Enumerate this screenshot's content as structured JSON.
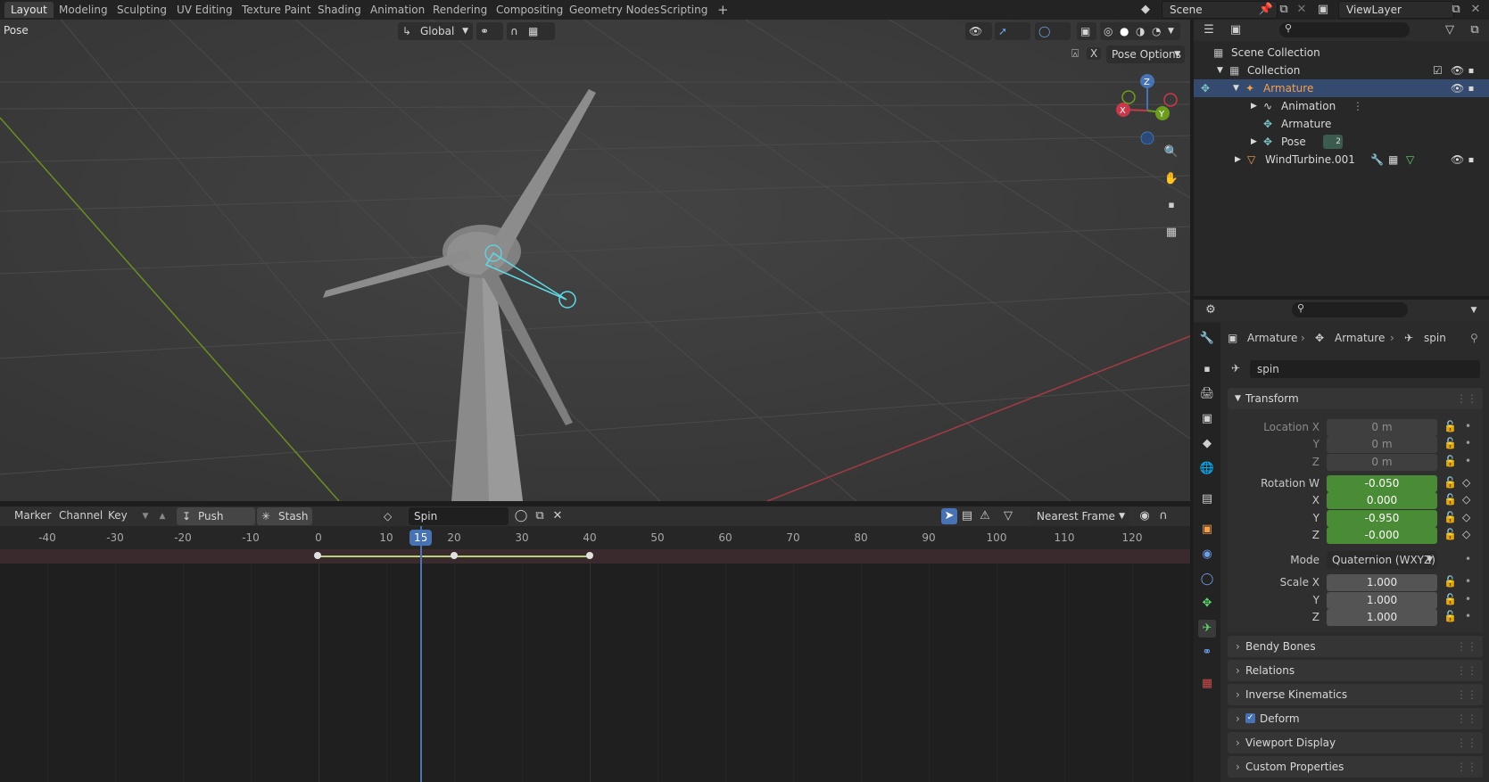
{
  "workspace_tabs": [
    "Layout",
    "Modeling",
    "Sculpting",
    "UV Editing",
    "Texture Paint",
    "Shading",
    "Animation",
    "Rendering",
    "Compositing",
    "Geometry Nodes",
    "Scripting",
    "+"
  ],
  "scene": "Scene",
  "view_layer": "ViewLayer",
  "viewport": {
    "mode": "Pose",
    "transform_orientation": "Global",
    "pose_options": "Pose Options",
    "x_mirror": "X"
  },
  "nla": {
    "menus": [
      "Marker",
      "Channel",
      "Key"
    ],
    "push_down": "Push Down",
    "stash": "Stash",
    "action_name": "Spin",
    "snap_mode": "Nearest Frame",
    "current_frame": "15",
    "ruler": [
      "-40",
      "-30",
      "-20",
      "-10",
      "0",
      "10",
      "20",
      "30",
      "40",
      "50",
      "60",
      "70",
      "80",
      "90",
      "100",
      "110",
      "120"
    ],
    "keyframes": [
      0,
      20,
      40
    ]
  },
  "outliner": {
    "rows": [
      {
        "label": "Scene Collection"
      },
      {
        "label": "Collection"
      },
      {
        "label": "Armature"
      },
      {
        "label": "Animation"
      },
      {
        "label": "Armature"
      },
      {
        "label": "Pose"
      },
      {
        "label": "WindTurbine.001"
      }
    ],
    "pose_badge": "2"
  },
  "properties": {
    "breadcrumb": [
      "Armature",
      "Armature",
      "spin"
    ],
    "bone_name": "spin",
    "transform_label": "Transform",
    "location_labels": [
      "Location X",
      "Y",
      "Z"
    ],
    "location_values": [
      "0 m",
      "0 m",
      "0 m"
    ],
    "rotation_labels": [
      "Rotation W",
      "X",
      "Y",
      "Z"
    ],
    "rotation_values": [
      "-0.050",
      "0.000",
      "-0.950",
      "-0.000"
    ],
    "mode_label": "Mode",
    "mode_value": "Quaternion (WXYZ)",
    "scale_labels": [
      "Scale X",
      "Y",
      "Z"
    ],
    "scale_values": [
      "1.000",
      "1.000",
      "1.000"
    ],
    "panels": [
      "Bendy Bones",
      "Relations",
      "Inverse Kinematics",
      "Deform",
      "Viewport Display",
      "Custom Properties"
    ]
  },
  "colors": {
    "accent_blue": "#4772b3",
    "keyed_green": "#4a8b35",
    "selected_orange": "#f5a04c",
    "bone_cyan": "#5fd9e6"
  }
}
